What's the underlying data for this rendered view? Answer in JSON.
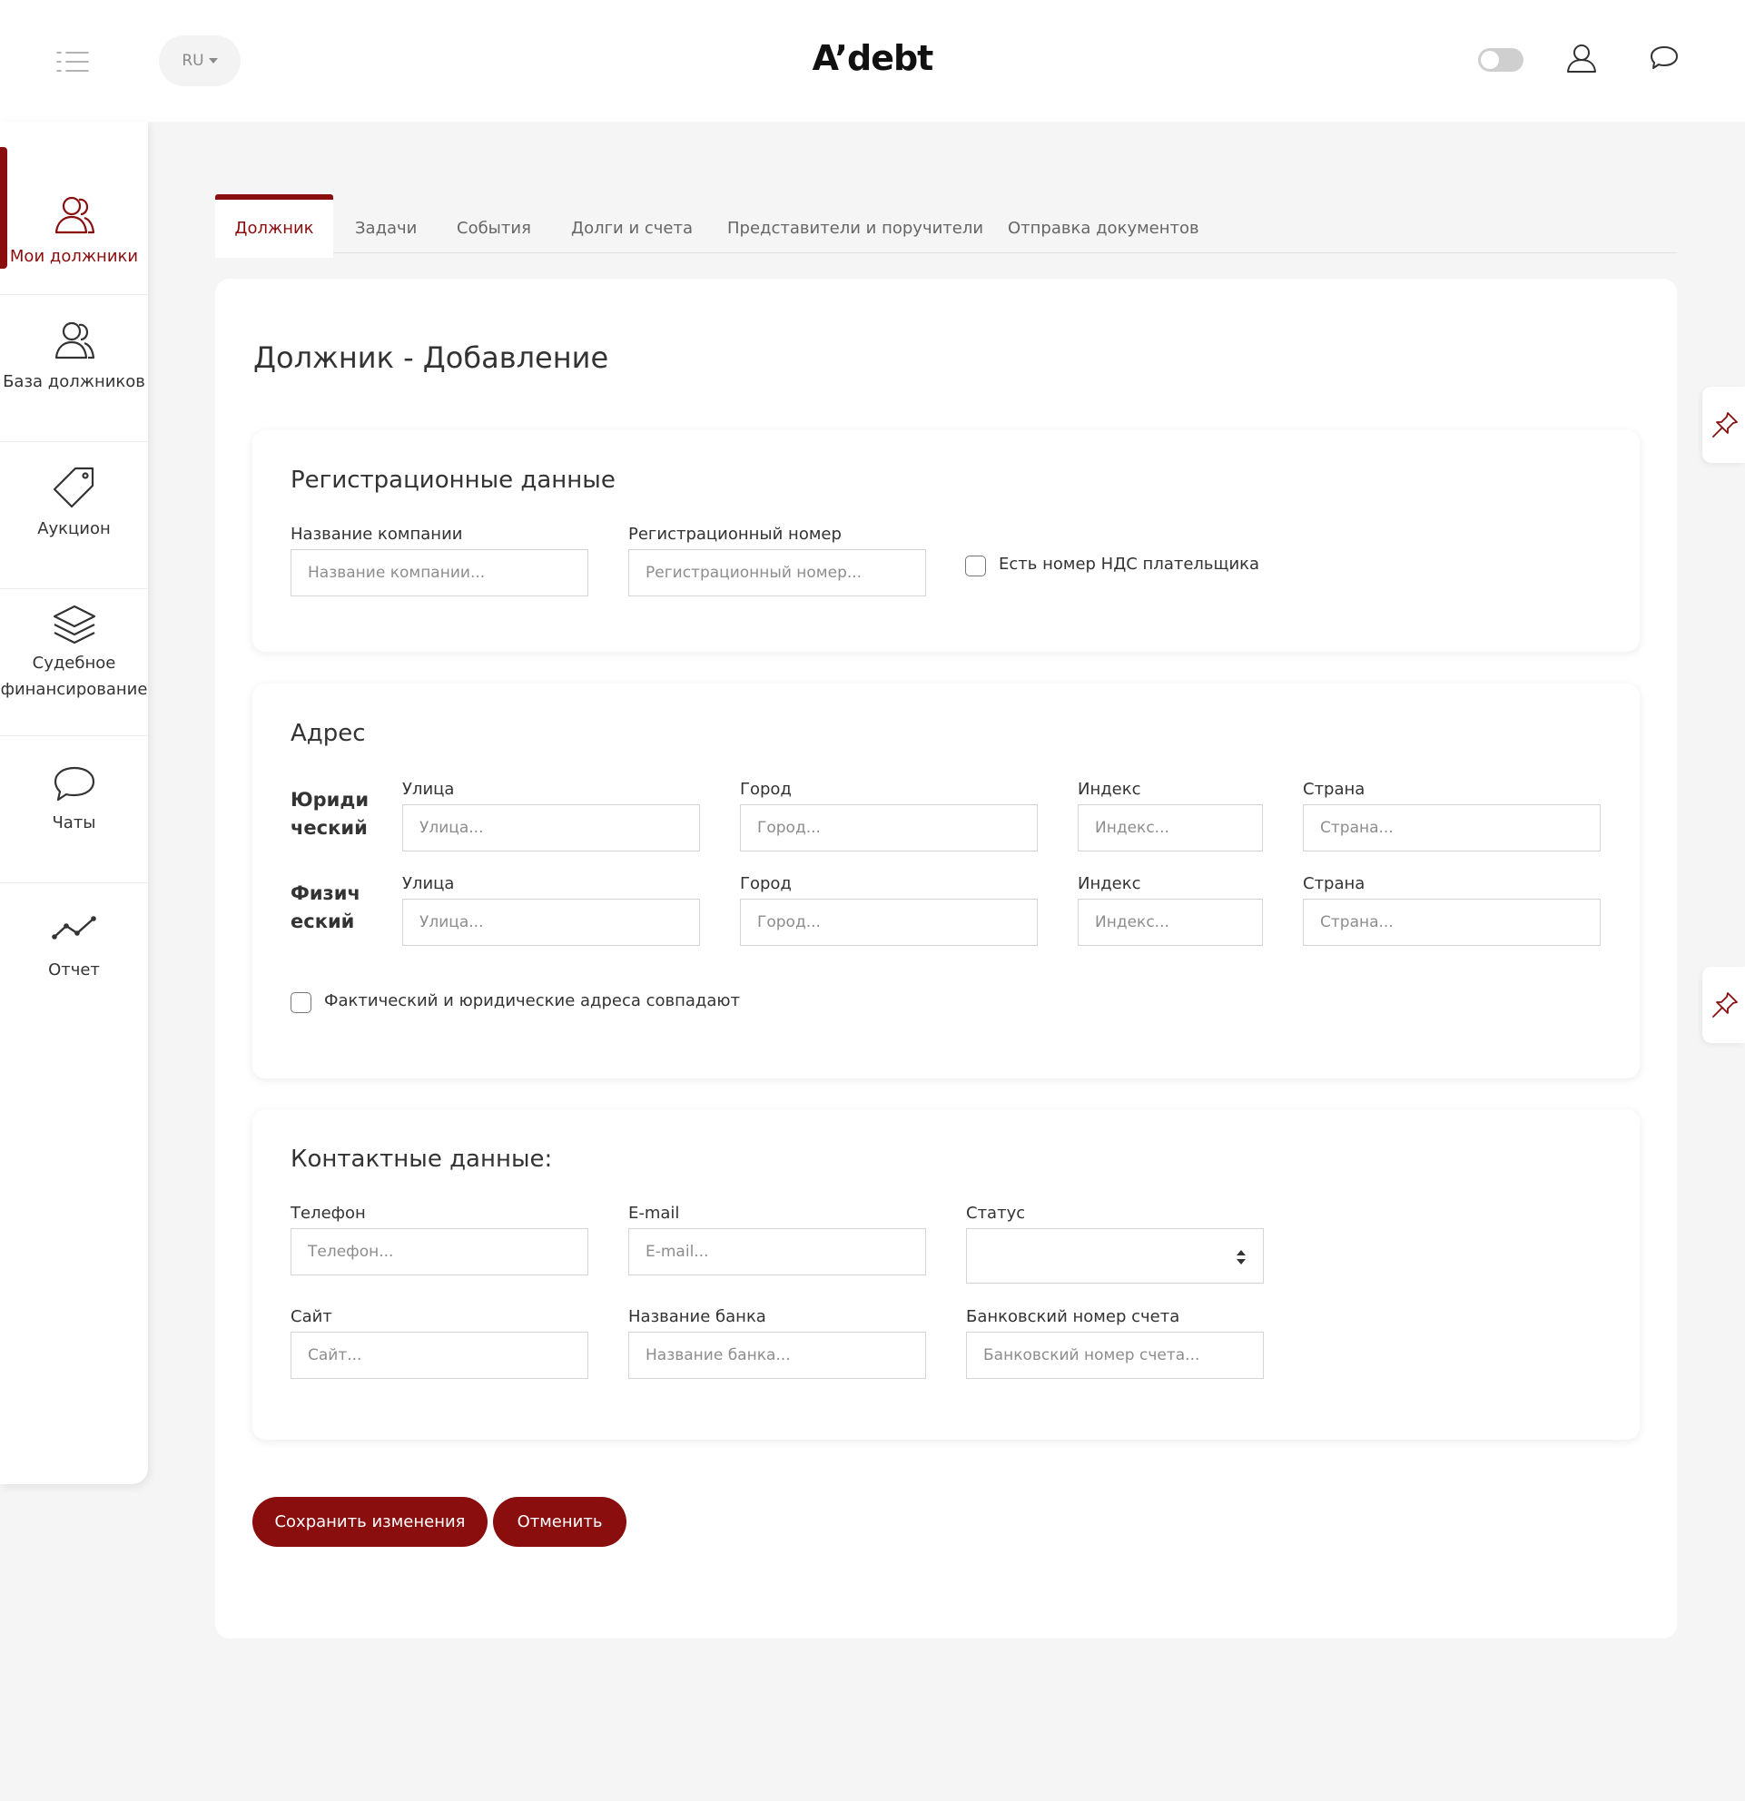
{
  "header": {
    "logo": "A’debt",
    "language": "RU",
    "icons": {
      "menu": "menu-list-icon",
      "theme_toggle": "toggle-switch",
      "profile": "user-icon",
      "messages": "chat-bubble-icon"
    }
  },
  "sidebar": {
    "items": [
      {
        "label": "Мои должники",
        "icon": "users-icon",
        "active": true
      },
      {
        "label": "База должников",
        "icon": "users-icon",
        "active": false
      },
      {
        "label": "Аукцион",
        "icon": "tag-icon",
        "active": false
      },
      {
        "label": "Судебное финансирование",
        "label_line1": "Судебное",
        "label_line2": "финансирование",
        "icon": "layers-icon",
        "active": false
      },
      {
        "label": "Чаты",
        "icon": "chat-bubble-icon",
        "active": false
      },
      {
        "label": "Отчет",
        "icon": "line-chart-icon",
        "active": false
      }
    ]
  },
  "tabs": [
    {
      "label": "Должник",
      "active": true
    },
    {
      "label": "Задачи"
    },
    {
      "label": "События"
    },
    {
      "label": "Долги и счета"
    },
    {
      "label": "Представители и поручители"
    },
    {
      "label": "Отправка документов"
    }
  ],
  "page": {
    "title": "Должник - Добавление"
  },
  "registration": {
    "title": "Регистрационные данные",
    "company_label": "Название компании",
    "company_placeholder": "Название компании...",
    "regnum_label": "Регистрационный номер",
    "regnum_placeholder": "Регистрационный номер...",
    "vat_checkbox_label": "Есть номер НДС плательщика",
    "vat_checked": false
  },
  "address": {
    "title": "Адрес",
    "legal": {
      "heading": "Юридический",
      "heading_line1": "Юриди",
      "heading_line2": "ческий",
      "street_label": "Улица",
      "street_placeholder": "Улица...",
      "city_label": "Город",
      "city_placeholder": "Город...",
      "zip_label": "Индекс",
      "zip_placeholder": "Индекс...",
      "country_label": "Страна",
      "country_placeholder": "Страна..."
    },
    "physical": {
      "heading": "Физический",
      "heading_line1": "Физич",
      "heading_line2": "еский",
      "street_label": "Улица",
      "street_placeholder": "Улица...",
      "city_label": "Город",
      "city_placeholder": "Город...",
      "zip_label": "Индекс",
      "zip_placeholder": "Индекс...",
      "country_label": "Страна",
      "country_placeholder": "Страна..."
    },
    "same_checkbox_label": "Фактический и юридические адреса совпадают",
    "same_checked": false
  },
  "contacts": {
    "title": "Контактные данные:",
    "phone_label": "Телефон",
    "phone_placeholder": "Телефон...",
    "email_label": "E-mail",
    "email_placeholder": "E-mail...",
    "status_label": "Статус",
    "status_value": "",
    "site_label": "Сайт",
    "site_placeholder": "Сайт...",
    "bank_label": "Название банка",
    "bank_placeholder": "Название банка...",
    "account_label": "Банковский номер счета",
    "account_placeholder": "Банковский номер счета..."
  },
  "actions": {
    "save": "Сохранить изменения",
    "cancel": "Отменить"
  },
  "colors": {
    "accent": "#8b0e0e",
    "background": "#f5f5f5",
    "card": "#ffffff"
  }
}
